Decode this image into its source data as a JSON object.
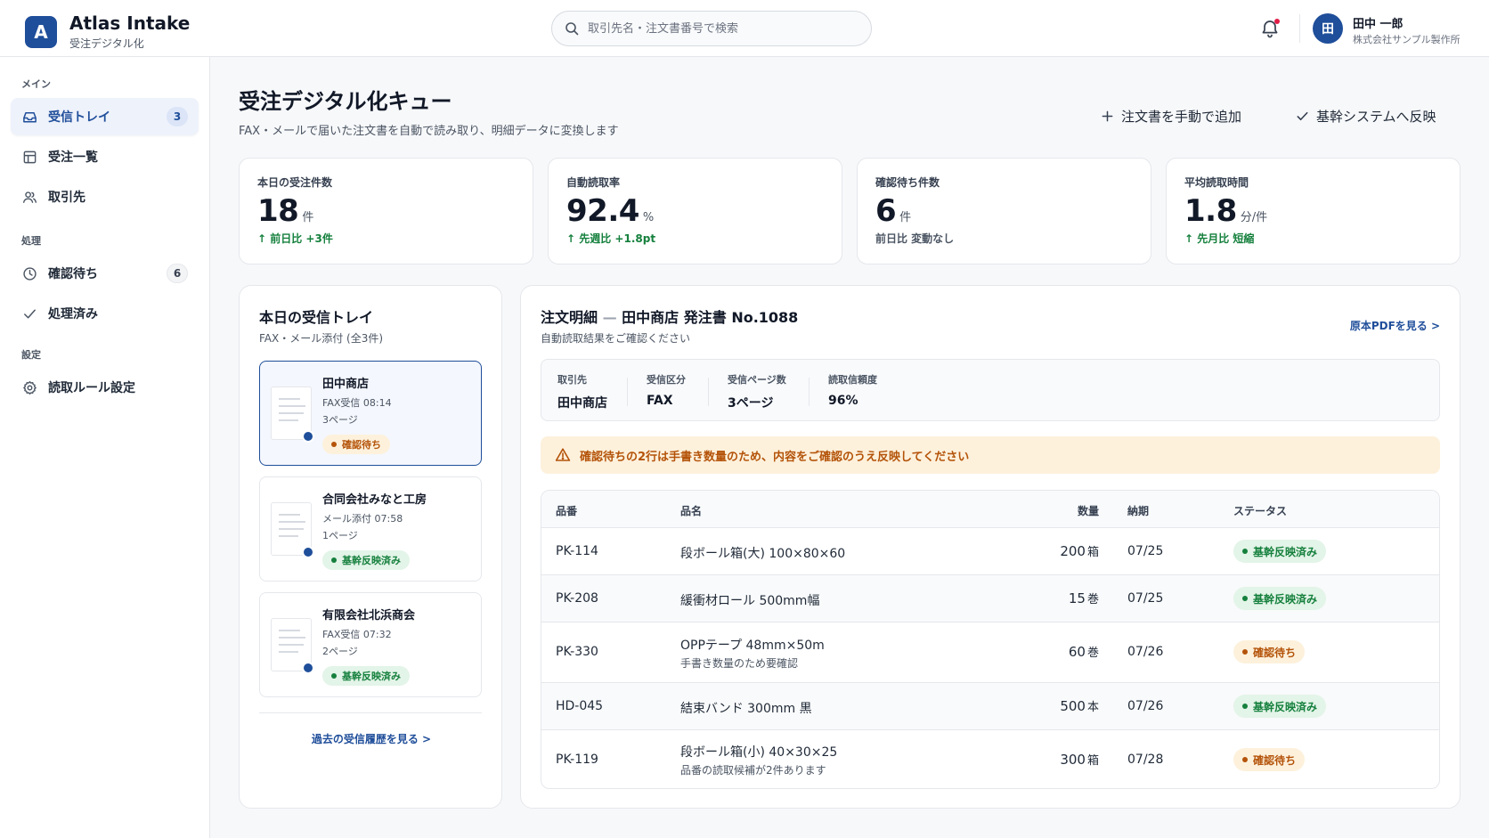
{
  "app": {
    "logo_letter": "A",
    "name": "Atlas Intake",
    "subtitle": "受注デジタル化"
  },
  "search": {
    "placeholder": "取引先名・注文書番号で検索"
  },
  "user": {
    "initial": "田",
    "name": "田中 一郎",
    "org": "株式会社サンプル製作所"
  },
  "sidebar": {
    "sections": [
      "メイン",
      "処理",
      "設定"
    ],
    "items": [
      {
        "label": "受信トレイ",
        "badge": "3",
        "icon": "inbox-icon",
        "active": true
      },
      {
        "label": "受注一覧",
        "icon": "table-icon"
      },
      {
        "label": "取引先",
        "icon": "users-icon"
      },
      {
        "label": "確認待ち",
        "badge": "6",
        "icon": "clock-icon"
      },
      {
        "label": "処理済み",
        "icon": "check-icon"
      },
      {
        "label": "読取ルール設定",
        "icon": "gear-icon"
      }
    ]
  },
  "page": {
    "title": "受注デジタル化キュー",
    "subtitle": "FAX・メールで届いた注文書を自動で読み取り、明細データに変換します",
    "actions": {
      "add_manual": "注文書を手動で追加",
      "sync": "基幹システムへ反映"
    }
  },
  "kpis": [
    {
      "label": "本日の受注件数",
      "value": "18",
      "unit": "件",
      "delta": "前日比 +3件",
      "trend": "up"
    },
    {
      "label": "自動読取率",
      "value": "92.4",
      "unit": "%",
      "delta": "先週比 +1.8pt",
      "trend": "up"
    },
    {
      "label": "確認待ち件数",
      "value": "6",
      "unit": "件",
      "delta": "前日比 変動なし",
      "trend": "flat"
    },
    {
      "label": "平均読取時間",
      "value": "1.8",
      "unit": "分/件",
      "delta": "先月比 短縮",
      "trend": "up"
    }
  ],
  "inbox": {
    "title": "本日の受信トレイ",
    "subtitle": "FAX・メール添付 (全3件)",
    "items": [
      {
        "name": "田中商店",
        "source": "FAX受信 08:14",
        "pages": "3ページ",
        "status": "確認待ち",
        "status_type": "warn",
        "icon": "fax-icon"
      },
      {
        "name": "合同会社みなと工房",
        "source": "メール添付 07:58",
        "pages": "1ページ",
        "status": "基幹反映済み",
        "status_type": "ok",
        "icon": "mail-icon"
      },
      {
        "name": "有限会社北浜商会",
        "source": "FAX受信 07:32",
        "pages": "2ページ",
        "status": "基幹反映済み",
        "status_type": "ok",
        "icon": "fax-icon"
      }
    ],
    "history_link": "過去の受信履歴を見る >"
  },
  "detail": {
    "title_prefix": "注文明細",
    "title_sep": "—",
    "title_main": "田中商店 発注書 No.1088",
    "subtitle": "自動読取結果をご確認ください",
    "pdf_link": "原本PDFを見る >",
    "summary": [
      {
        "label": "取引先",
        "value": "田中商店"
      },
      {
        "label": "受信区分",
        "value": "FAX"
      },
      {
        "label": "受信ページ数",
        "value": "3ページ"
      },
      {
        "label": "読取信頼度",
        "value": "96%"
      }
    ],
    "alert": "確認待ちの2行は手書き数量のため、内容をご確認のうえ反映してください",
    "columns": {
      "code": "品番",
      "name": "品名",
      "qty": "数量",
      "due": "納期",
      "status": "ステータス"
    },
    "rows": [
      {
        "code": "PK-114",
        "name": "段ボール箱(大) 100×80×60",
        "note": "",
        "qty": "200",
        "unit": "箱",
        "due": "07/25",
        "status": "基幹反映済み",
        "status_type": "ok"
      },
      {
        "code": "PK-208",
        "name": "緩衝材ロール 500mm幅",
        "note": "",
        "qty": "15",
        "unit": "巻",
        "due": "07/25",
        "status": "基幹反映済み",
        "status_type": "ok"
      },
      {
        "code": "PK-330",
        "name": "OPPテープ 48mm×50m",
        "note": "手書き数量のため要確認",
        "qty": "60",
        "unit": "巻",
        "due": "07/26",
        "status": "確認待ち",
        "status_type": "warn"
      },
      {
        "code": "HD-045",
        "name": "結束バンド 300mm 黒",
        "note": "",
        "qty": "500",
        "unit": "本",
        "due": "07/26",
        "status": "基幹反映済み",
        "status_type": "ok"
      },
      {
        "code": "PK-119",
        "name": "段ボール箱(小) 40×30×25",
        "note": "品番の読取候補が2件あります",
        "qty": "300",
        "unit": "箱",
        "due": "07/28",
        "status": "確認待ち",
        "status_type": "warn"
      }
    ]
  },
  "colors": {
    "brand": "#1f4e9a",
    "ok": "#15803d",
    "warn": "#b45309",
    "alert_dot": "#e11d48"
  }
}
